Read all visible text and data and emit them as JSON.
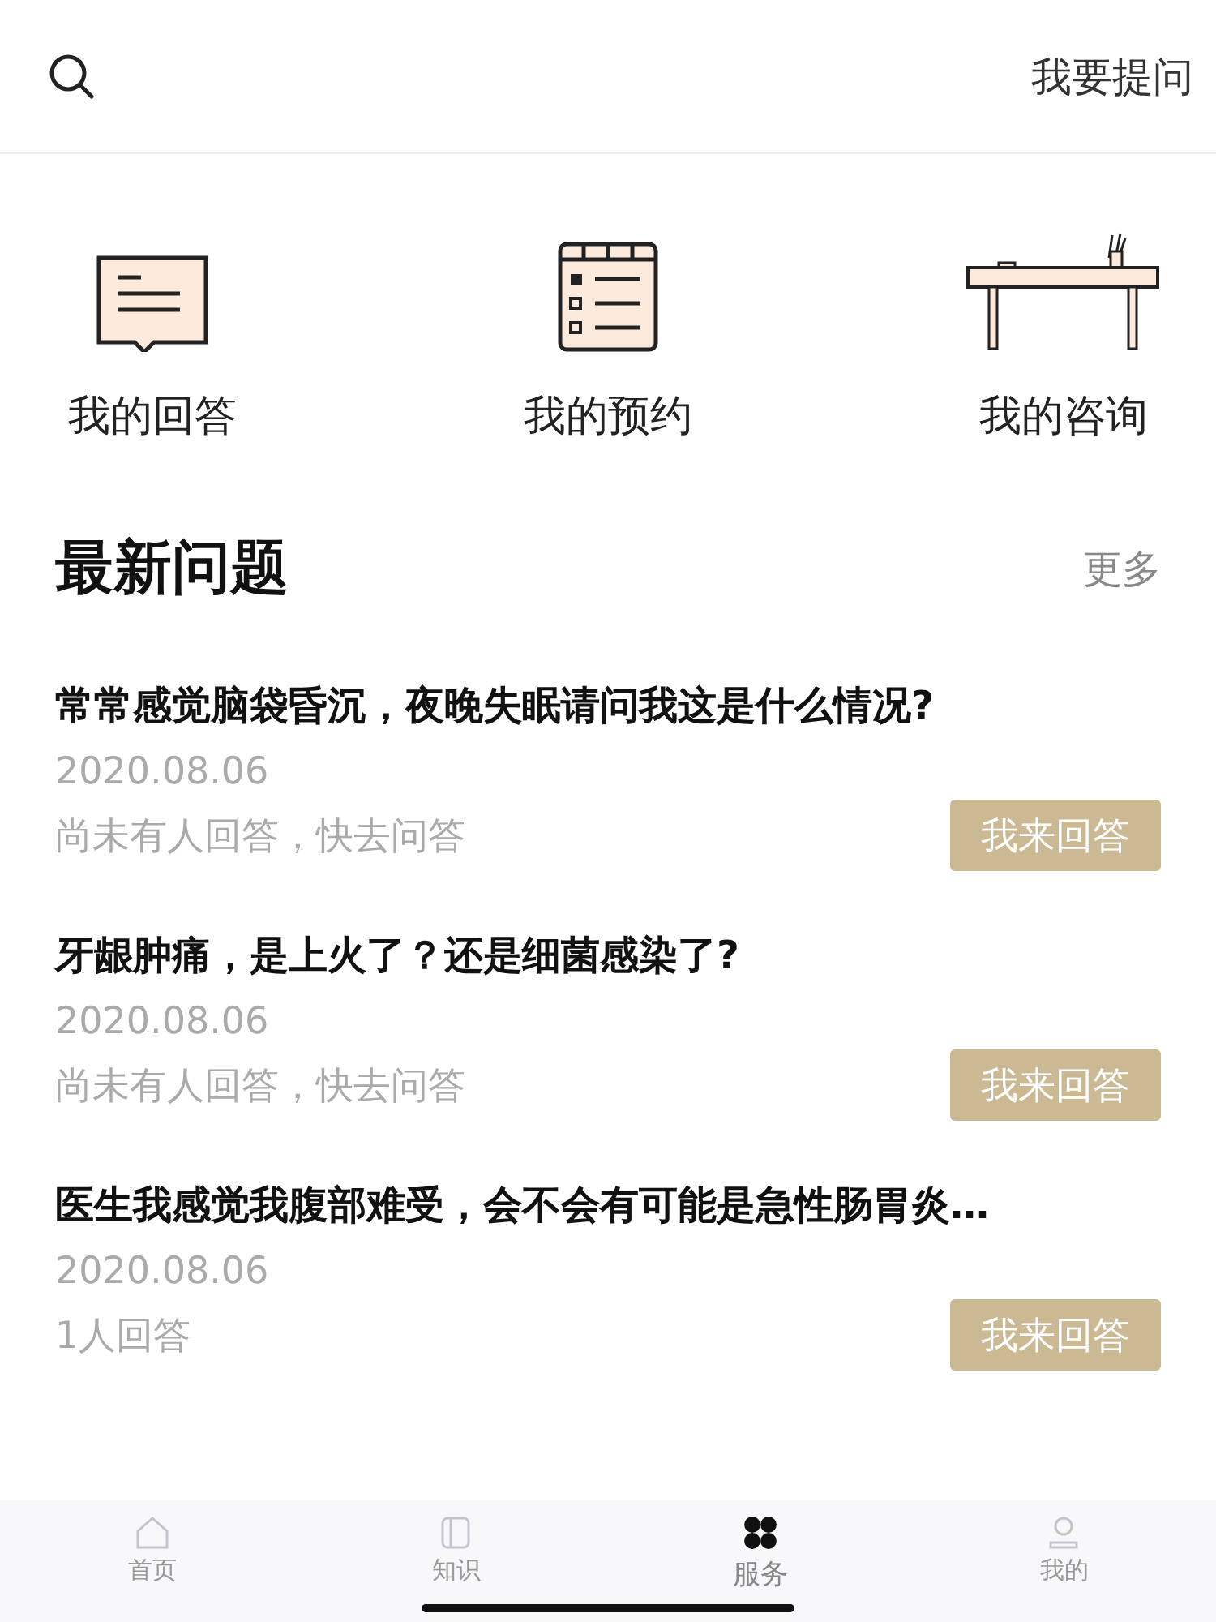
{
  "header": {
    "action": "我要提问"
  },
  "shortcuts": [
    {
      "kind": "message",
      "label": "我的回答"
    },
    {
      "kind": "calendar",
      "label": "我的预约"
    },
    {
      "kind": "desk",
      "label": "我的咨询"
    }
  ],
  "section": {
    "title": "最新问题",
    "more": "更多"
  },
  "questions": [
    {
      "title": "常常感觉脑袋昏沉，夜晚失眠请问我这是什么情况?",
      "date": "2020.08.06",
      "status": "尚未有人回答，快去问答",
      "button": "我来回答"
    },
    {
      "title": "牙龈肿痛，是上火了？还是细菌感染了?",
      "date": "2020.08.06",
      "status": "尚未有人回答，快去问答",
      "button": "我来回答"
    },
    {
      "title": "医生我感觉我腹部难受，会不会有可能是急性肠胃炎…",
      "date": "2020.08.06",
      "status": "1人回答",
      "button": "我来回答"
    }
  ],
  "tabs": [
    {
      "kind": "home",
      "label": "首页",
      "selected": false
    },
    {
      "kind": "book",
      "label": "知识",
      "selected": false
    },
    {
      "kind": "grid",
      "label": "服务",
      "selected": true
    },
    {
      "kind": "user",
      "label": "我的",
      "selected": false
    }
  ]
}
